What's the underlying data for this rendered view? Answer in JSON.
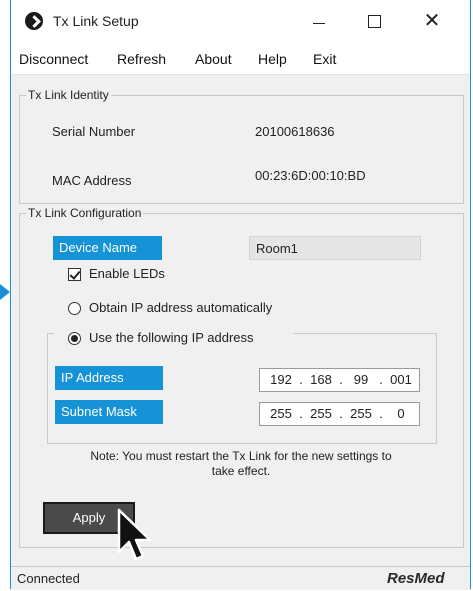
{
  "window": {
    "title": "Tx Link Setup",
    "accent": "#1a8fd8"
  },
  "menu": [
    "Disconnect",
    "Refresh",
    "About",
    "Help",
    "Exit"
  ],
  "identity": {
    "legend": "Tx Link Identity",
    "serial_label": "Serial Number",
    "serial_value": "20100618636",
    "mac_label": "MAC Address",
    "mac_value": "00:23:6D:00:10:BD"
  },
  "config": {
    "legend": "Tx Link Configuration",
    "device_name_label": "Device Name",
    "device_name_value": "Room1",
    "enable_leds_label": "Enable LEDs",
    "enable_leds_checked": true,
    "obtain_ip_label": "Obtain IP address automatically",
    "use_ip_label": "Use the following IP address",
    "selected_ip_mode": "manual",
    "ip_label": "IP Address",
    "ip": [
      "192",
      "168",
      "99",
      "001"
    ],
    "subnet_label": "Subnet Mask",
    "subnet": [
      "255",
      "255",
      "255",
      "0"
    ],
    "note_line1": "Note: You must restart the Tx Link for the new settings to",
    "note_line2": "take effect.",
    "apply_label": "Apply",
    "highlight_color": "#1593d6"
  },
  "status": {
    "text": "Connected",
    "brand": "ResMed"
  }
}
